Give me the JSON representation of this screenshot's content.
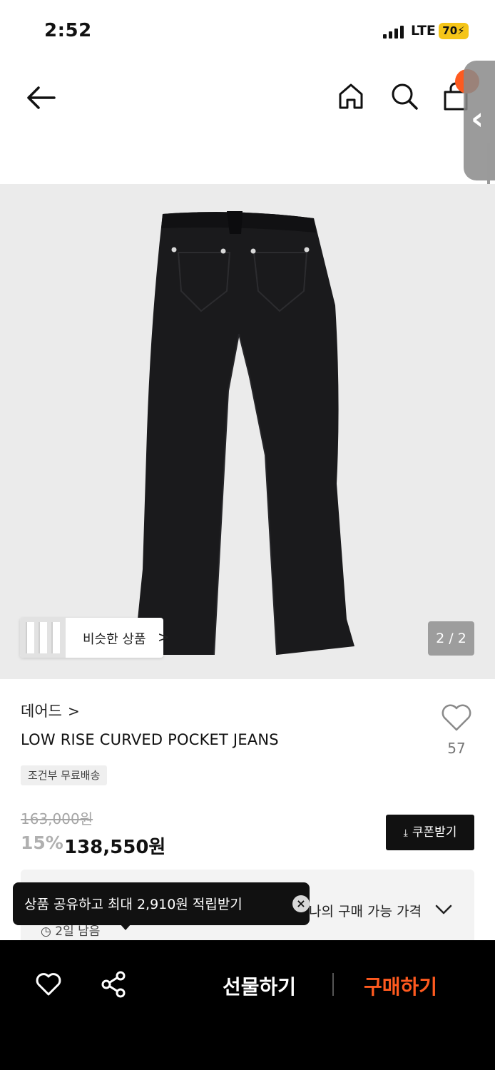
{
  "status": {
    "time": "2:52",
    "network": "LTE",
    "battery": "70"
  },
  "nav": {
    "icons": [
      "back-arrow-icon",
      "home-icon",
      "search-icon",
      "shopping-bag-icon"
    ]
  },
  "gallery": {
    "similar_label": "비슷한 상품",
    "similar_chevron": ">",
    "page_counter": "2 / 2"
  },
  "product": {
    "brand": "데어드",
    "brand_chevron": ">",
    "name": "LOW RISE CURVED POCKET JEANS",
    "like_count": "57",
    "shipping_badge": "조건부 무료배송",
    "original_price": "163,000원",
    "discount": "15%",
    "sale_price": "138,550원",
    "coupon_label": "쿠폰받기"
  },
  "price_panel": {
    "label": "나의 구매 가능 가격",
    "time_text": "2일 남음"
  },
  "toast": {
    "text": "상품 공유하고 최대 2,910원 적립받기",
    "close": "×"
  },
  "bottom_bar": {
    "gift_label": "선물하기",
    "buy_label": "구매하기"
  },
  "colors": {
    "accent": "#ff5a1f",
    "battery": "#f5c518",
    "image_bg": "#ebebeb"
  }
}
